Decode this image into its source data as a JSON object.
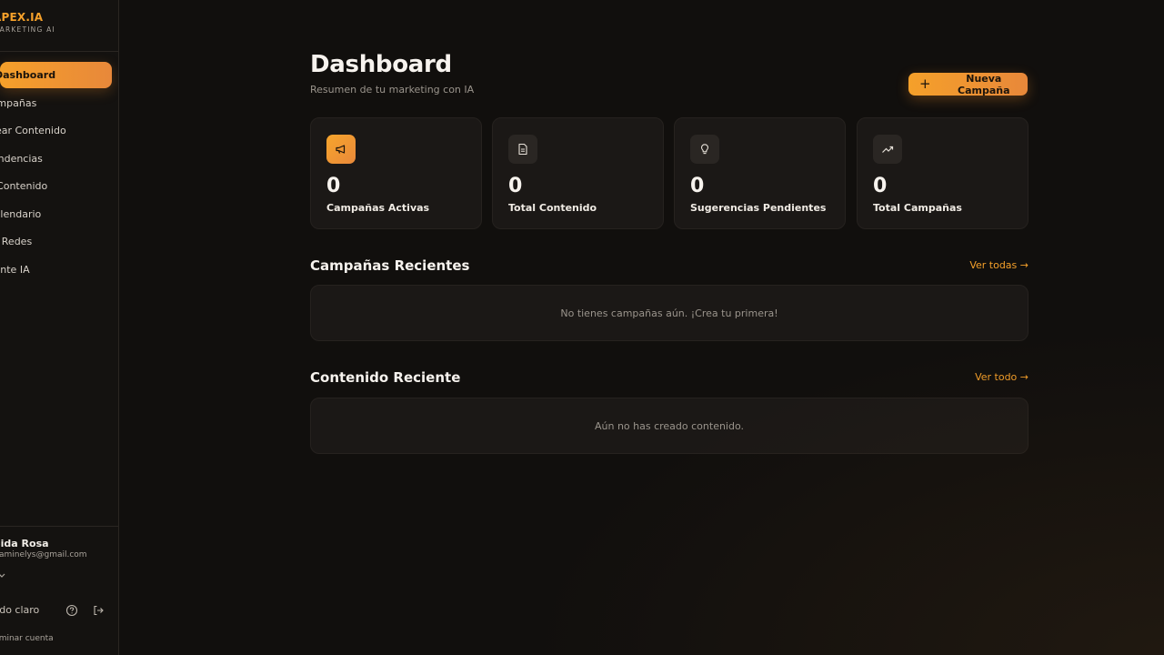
{
  "brand": {
    "name": "APEX.IA",
    "tagline": "MARKETING AI"
  },
  "sidebar": {
    "items": [
      {
        "label": "Dashboard",
        "active": true
      },
      {
        "label": "Campañas"
      },
      {
        "label": "Crear Contenido"
      },
      {
        "label": "Tendencias"
      },
      {
        "label": "Mi Contenido"
      },
      {
        "label": "Calendario"
      },
      {
        "label": "Mis Redes"
      },
      {
        "label": "Agente IA"
      }
    ],
    "user": {
      "name": "Oneida Rosa",
      "email": "oneidaminelys@gmail.com"
    },
    "theme_label": "Modo claro",
    "delete_account_label": "Eliminar cuenta"
  },
  "header": {
    "title": "Dashboard",
    "subtitle": "Resumen de tu marketing con IA",
    "new_campaign_label": "Nueva Campaña"
  },
  "stats": [
    {
      "value": "0",
      "label": "Campañas Activas",
      "icon": "megaphone-icon"
    },
    {
      "value": "0",
      "label": "Total Contenido",
      "icon": "document-icon"
    },
    {
      "value": "0",
      "label": "Sugerencias Pendientes",
      "icon": "lightbulb-icon"
    },
    {
      "value": "0",
      "label": "Total Campañas",
      "icon": "trending-up-icon"
    }
  ],
  "recent_campaigns": {
    "title": "Campañas Recientes",
    "link": "Ver todas →",
    "empty": "No tienes campañas aún. ¡Crea tu primera!"
  },
  "recent_content": {
    "title": "Contenido Reciente",
    "link": "Ver todo →",
    "empty": "Aún no has creado contenido."
  },
  "colors": {
    "accent": "#f5a02a",
    "accent_end": "#e8883a",
    "background": "#110f0d",
    "card": "#1b1816"
  }
}
